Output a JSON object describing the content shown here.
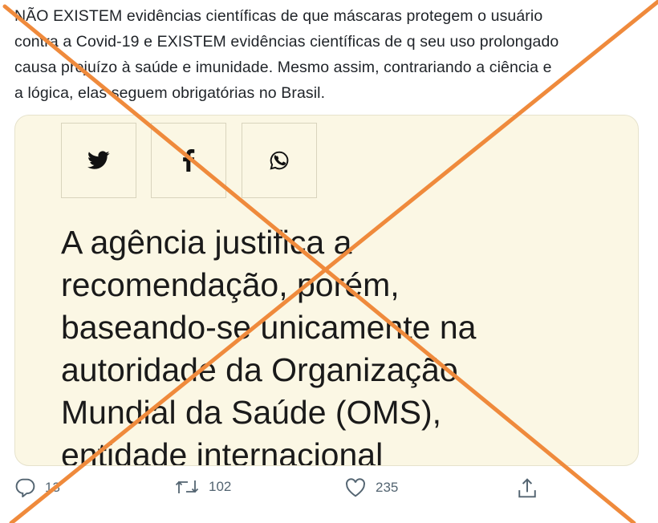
{
  "tweet": {
    "text_lines": [
      "NÃO EXISTEM evidências científicas de que máscaras protegem o usuário",
      "contra a Covid-19 e EXISTEM evidências científicas de q seu uso prolongado",
      "causa prejuízo à saúde e imunidade. Mesmo assim, contrariando a ciência e",
      "a lógica, elas seguem obrigatórias no Brasil."
    ]
  },
  "card": {
    "share_buttons": [
      {
        "icon": "twitter-icon"
      },
      {
        "icon": "facebook-icon"
      },
      {
        "icon": "whatsapp-icon"
      }
    ],
    "headline_lines": [
      "A agência justifica a",
      "recomendação, porém,",
      "baseando-se unicamente na",
      "autoridade da Organização",
      "Mundial da Saúde (OMS),",
      "entidade internacional"
    ],
    "background_color": "#fbf7e4"
  },
  "actions": {
    "reply_count": "13",
    "retweet_count": "102",
    "like_count": "235"
  },
  "overlay": {
    "type": "cross-mark",
    "color": "#ef8a3c"
  }
}
